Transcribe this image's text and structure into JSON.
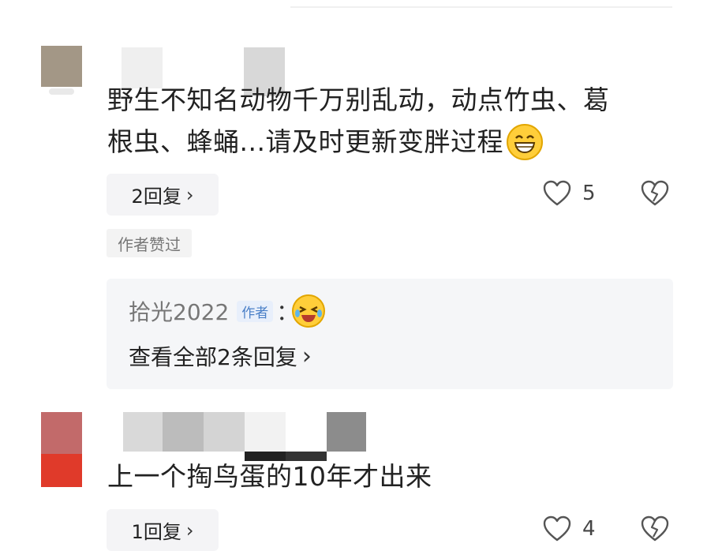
{
  "comments": [
    {
      "text_line1": "野生不知名动物千万别乱动，动点竹虫、葛",
      "text_line2": "根虫、蜂蛹...请及时更新变胖过程",
      "emoji": "grinning-face",
      "reply_label": "2回复",
      "like_count": "5",
      "author_liked": "作者赞过",
      "reply_preview": {
        "name": "拾光2022",
        "author_tag": "作者",
        "separator": "：",
        "emoji": "crying-laughing-face",
        "view_all": "查看全部2条回复"
      }
    },
    {
      "text": "上一个掏鸟蛋的10年才出来",
      "reply_label": "1回复",
      "like_count": "4"
    }
  ],
  "icons": {
    "like": "heart-outline-icon",
    "dislike": "broken-heart-icon",
    "chevron": "chevron-right-icon"
  },
  "colors": {
    "author_tag": "#4a7fc7",
    "reply_panel_bg": "#f5f6f8",
    "emoji_yellow": "#ffce3a"
  }
}
